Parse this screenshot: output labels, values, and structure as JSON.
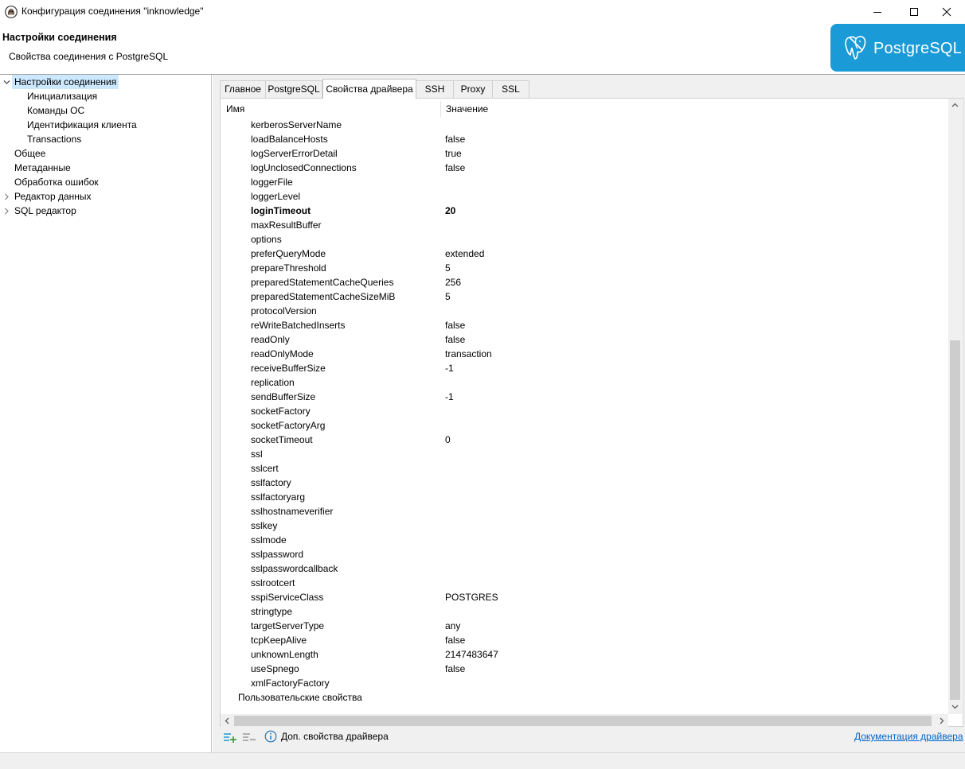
{
  "window": {
    "title": "Конфигурация соединения \"inknowledge\""
  },
  "header": {
    "title": "Настройки соединения",
    "subtitle": "Свойства соединения с PostgreSQL",
    "logo_text": "PostgreSQL",
    "brand_color": "#1a9ad6"
  },
  "nav": {
    "items": [
      {
        "label": "Настройки соединения",
        "level": 0,
        "expander": "expanded",
        "selected": true
      },
      {
        "label": "Инициализация",
        "level": 1
      },
      {
        "label": "Команды ОС",
        "level": 1
      },
      {
        "label": "Идентификация клиента",
        "level": 1
      },
      {
        "label": "Transactions",
        "level": 1
      },
      {
        "label": "Общее",
        "level": 0
      },
      {
        "label": "Метаданные",
        "level": 0
      },
      {
        "label": "Обработка ошибок",
        "level": 0
      },
      {
        "label": "Редактор данных",
        "level": 0,
        "expander": "collapsed"
      },
      {
        "label": "SQL редактор",
        "level": 0,
        "expander": "collapsed"
      }
    ]
  },
  "tabs": [
    {
      "label": "Главное"
    },
    {
      "label": "PostgreSQL"
    },
    {
      "label": "Свойства драйвера",
      "active": true
    },
    {
      "label": "SSH"
    },
    {
      "label": "Proxy"
    },
    {
      "label": "SSL"
    }
  ],
  "table": {
    "columns": {
      "name": "Имя",
      "value": "Значение"
    },
    "rows": [
      {
        "name": "kerberosServerName",
        "value": ""
      },
      {
        "name": "loadBalanceHosts",
        "value": "false"
      },
      {
        "name": "logServerErrorDetail",
        "value": "true"
      },
      {
        "name": "logUnclosedConnections",
        "value": "false"
      },
      {
        "name": "loggerFile",
        "value": ""
      },
      {
        "name": "loggerLevel",
        "value": ""
      },
      {
        "name": "loginTimeout",
        "value": "20",
        "bold": true
      },
      {
        "name": "maxResultBuffer",
        "value": ""
      },
      {
        "name": "options",
        "value": ""
      },
      {
        "name": "preferQueryMode",
        "value": "extended"
      },
      {
        "name": "prepareThreshold",
        "value": "5"
      },
      {
        "name": "preparedStatementCacheQueries",
        "value": "256"
      },
      {
        "name": "preparedStatementCacheSizeMiB",
        "value": "5"
      },
      {
        "name": "protocolVersion",
        "value": ""
      },
      {
        "name": "reWriteBatchedInserts",
        "value": "false"
      },
      {
        "name": "readOnly",
        "value": "false"
      },
      {
        "name": "readOnlyMode",
        "value": "transaction"
      },
      {
        "name": "receiveBufferSize",
        "value": "-1"
      },
      {
        "name": "replication",
        "value": ""
      },
      {
        "name": "sendBufferSize",
        "value": "-1"
      },
      {
        "name": "socketFactory",
        "value": ""
      },
      {
        "name": "socketFactoryArg",
        "value": ""
      },
      {
        "name": "socketTimeout",
        "value": "0"
      },
      {
        "name": "ssl",
        "value": ""
      },
      {
        "name": "sslcert",
        "value": ""
      },
      {
        "name": "sslfactory",
        "value": ""
      },
      {
        "name": "sslfactoryarg",
        "value": ""
      },
      {
        "name": "sslhostnameverifier",
        "value": ""
      },
      {
        "name": "sslkey",
        "value": ""
      },
      {
        "name": "sslmode",
        "value": ""
      },
      {
        "name": "sslpassword",
        "value": ""
      },
      {
        "name": "sslpasswordcallback",
        "value": ""
      },
      {
        "name": "sslrootcert",
        "value": ""
      },
      {
        "name": "sspiServiceClass",
        "value": "POSTGRES"
      },
      {
        "name": "stringtype",
        "value": ""
      },
      {
        "name": "targetServerType",
        "value": "any"
      },
      {
        "name": "tcpKeepAlive",
        "value": "false"
      },
      {
        "name": "unknownLength",
        "value": "2147483647"
      },
      {
        "name": "useSpnego",
        "value": "false"
      },
      {
        "name": "xmlFactoryFactory",
        "value": ""
      }
    ],
    "user_group": "Пользовательские свойства"
  },
  "toolbar": {
    "add_icon": "add-property-icon",
    "remove_icon": "remove-property-icon",
    "info_icon": "info-icon",
    "info_label": "Доп. свойства драйвера",
    "doc_link": "Документация драйвера"
  },
  "colors": {
    "selection": "#cce8ff",
    "link": "#0066cc",
    "accent_icon": "#1a9ad6"
  }
}
